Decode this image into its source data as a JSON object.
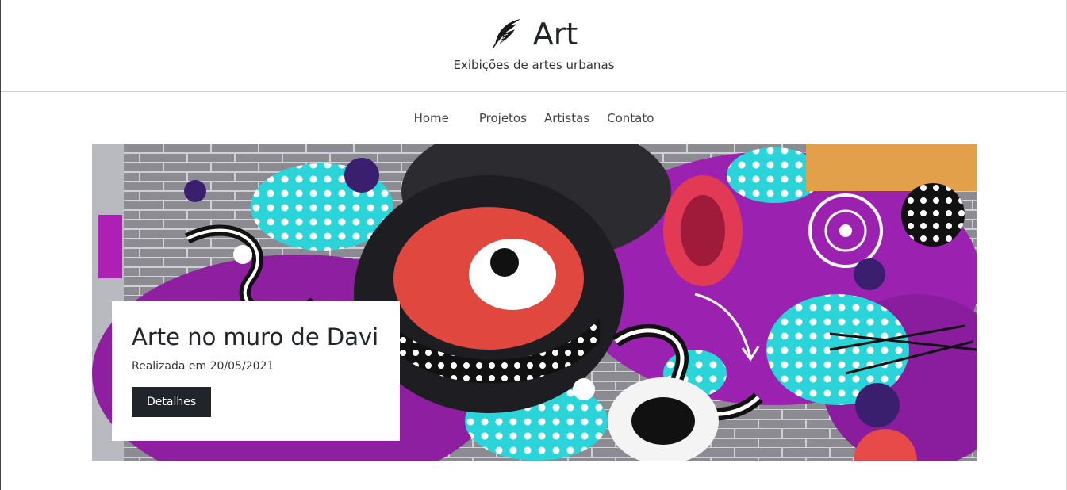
{
  "brand": {
    "icon": "feather-quill-icon",
    "name": "Art",
    "tagline": "Exibições de artes urbanas"
  },
  "nav": {
    "items": [
      {
        "label": "Home"
      },
      {
        "label": "Projetos"
      },
      {
        "label": "Artistas"
      },
      {
        "label": "Contato"
      }
    ]
  },
  "hero": {
    "image": "graffiti-mural-image",
    "title": "Arte no muro de Davi",
    "date": "Realizada em 20/05/2021",
    "button_label": "Detalhes"
  },
  "colors": {
    "text": "#212529",
    "button_bg": "#212529",
    "button_text": "#ffffff",
    "divider": "#cfcfcf"
  }
}
